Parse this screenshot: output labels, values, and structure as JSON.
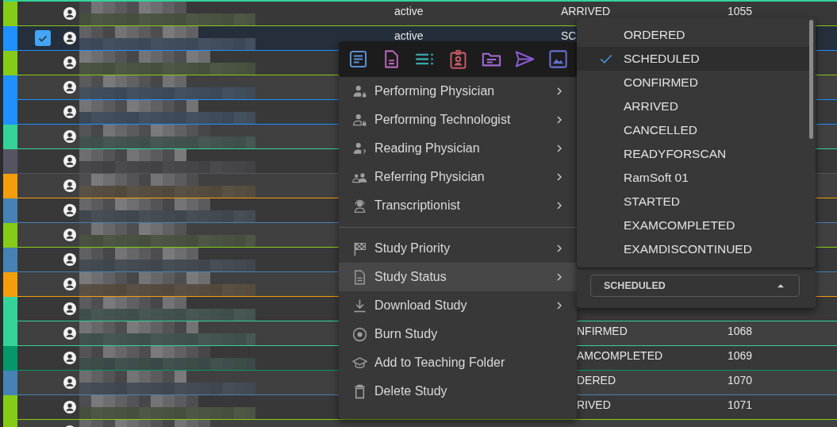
{
  "rows": [
    {
      "color": "#84cc16",
      "selected": false,
      "state": "active",
      "status": "ARRIVED",
      "status_cut": false,
      "number": "1055"
    },
    {
      "color": "#1e90ff",
      "selected": true,
      "state": "active",
      "status": "SC",
      "status_cut": false
    },
    {
      "color": "#84cc16",
      "selected": false
    },
    {
      "color": "#1e90ff",
      "selected": false
    },
    {
      "color": "#1e90ff",
      "selected": false
    },
    {
      "color": "#34d399",
      "selected": false
    },
    {
      "color": "#555562",
      "selected": false
    },
    {
      "color": "#f59e0b",
      "selected": false
    },
    {
      "color": "#4682b4",
      "selected": false
    },
    {
      "color": "#84cc16",
      "selected": false
    },
    {
      "color": "#4682b4",
      "selected": false
    },
    {
      "color": "#f59e0b",
      "selected": false
    },
    {
      "color": "#34d399",
      "selected": false
    },
    {
      "color": "#34d399",
      "selected": false,
      "status": "NFIRMED",
      "status_cut": true,
      "number": "1068"
    },
    {
      "color": "#059669",
      "selected": false,
      "status": "AMCOMPLETED",
      "status_cut": true,
      "number": "1069"
    },
    {
      "color": "#4682b4",
      "selected": false,
      "status": "DERED",
      "status_cut": true,
      "number": "1070"
    },
    {
      "color": "#84cc16",
      "selected": false,
      "status": "RIVED",
      "status_cut": true,
      "number": "1071"
    },
    {
      "color": "#84cc16",
      "selected": false
    }
  ],
  "context_menu": {
    "groups": [
      [
        {
          "label": "Performing Physician",
          "submenu": true,
          "selected": false
        },
        {
          "label": "Performing Technologist",
          "submenu": true,
          "selected": false
        },
        {
          "label": "Reading Physician",
          "submenu": true,
          "selected": false
        },
        {
          "label": "Referring Physician",
          "submenu": true,
          "selected": false
        },
        {
          "label": "Transcriptionist",
          "submenu": true,
          "selected": false
        }
      ],
      [
        {
          "label": "Study Priority",
          "submenu": true,
          "selected": false
        },
        {
          "label": "Study Status",
          "submenu": true,
          "selected": true
        },
        {
          "label": "Download Study",
          "submenu": true,
          "selected": false
        },
        {
          "label": "Burn Study",
          "submenu": false,
          "selected": false
        },
        {
          "label": "Add to Teaching Folder",
          "submenu": false,
          "selected": false
        },
        {
          "label": "Delete Study",
          "submenu": false,
          "selected": false
        }
      ]
    ]
  },
  "status_menu": {
    "options": [
      {
        "label": "ORDERED",
        "selected": false
      },
      {
        "label": "SCHEDULED",
        "selected": true
      },
      {
        "label": "CONFIRMED",
        "selected": false
      },
      {
        "label": "ARRIVED",
        "selected": false
      },
      {
        "label": "CANCELLED",
        "selected": false
      },
      {
        "label": "READYFORSCAN",
        "selected": false
      },
      {
        "label": "RamSoft 01",
        "selected": false
      },
      {
        "label": "STARTED",
        "selected": false
      },
      {
        "label": "EXAMCOMPLETED",
        "selected": false
      },
      {
        "label": "EXAMDISCONTINUED",
        "selected": false
      }
    ],
    "field": {
      "value": "SCHEDULED"
    }
  }
}
